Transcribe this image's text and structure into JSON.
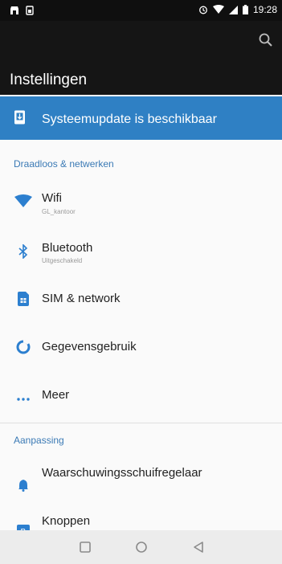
{
  "status_bar": {
    "time": "19:28",
    "left_icons": [
      "shop-icon",
      "sim-card-icon"
    ],
    "right_icons": [
      "alarm-icon",
      "wifi-icon",
      "signal-icon",
      "battery-icon"
    ]
  },
  "app_bar": {
    "title": "Instellingen",
    "search_icon": "search-icon"
  },
  "update_banner": {
    "label": "Systeemupdate is beschikbaar",
    "icon": "phone-update-icon"
  },
  "sections": [
    {
      "header": "Draadloos & netwerken",
      "items": [
        {
          "title": "Wifi",
          "subtitle": "GL_kantoor",
          "icon": "wifi-icon"
        },
        {
          "title": "Bluetooth",
          "subtitle": "Uitgeschakeld",
          "icon": "bluetooth-icon"
        },
        {
          "title": "SIM & network",
          "subtitle": "",
          "icon": "sim-card-icon"
        },
        {
          "title": "Gegevensgebruik",
          "subtitle": "",
          "icon": "data-usage-icon"
        },
        {
          "title": "Meer",
          "subtitle": "",
          "icon": "more-icon"
        }
      ]
    },
    {
      "header": "Aanpassing",
      "items": [
        {
          "title": "Waarschuwingsschuifregelaar",
          "subtitle": "",
          "icon": "bell-icon"
        },
        {
          "title": "Knoppen",
          "subtitle": "",
          "icon": "button-icon"
        }
      ]
    }
  ],
  "nav_bar": {
    "buttons": [
      "recents-icon",
      "home-icon",
      "back-icon"
    ]
  },
  "colors": {
    "accent": "#2f80c4",
    "icon_blue": "#2c7fcf",
    "app_bar": "#151515",
    "status_bar": "#0f0f0f"
  }
}
